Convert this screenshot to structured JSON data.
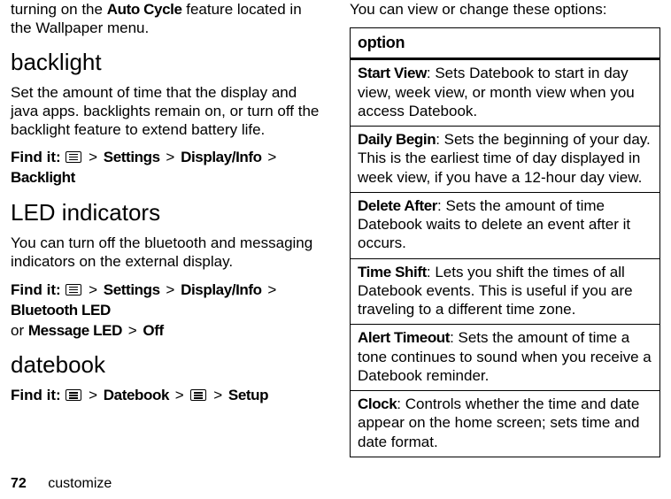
{
  "left": {
    "intro_pre": "turning on the ",
    "intro_bold": "Auto Cycle",
    "intro_post": " feature located in the Wallpaper menu.",
    "backlight_h": "backlight",
    "backlight_p": "Set the amount of time that the display and java apps. backlights remain on, or turn off the backlight feature to extend battery life.",
    "backlight_find_label": "Find it:",
    "backlight_find_s1": "Settings",
    "backlight_find_s2": "Display/Info",
    "backlight_find_s3": "Backlight",
    "led_h": "LED indicators",
    "led_p": "You can turn off the bluetooth and messaging indicators on the external display.",
    "led_find_label": "Find it:",
    "led_find_s1": "Settings",
    "led_find_s2": "Display/Info",
    "led_find_s3": "Bluetooth LED",
    "led_find_or": "or ",
    "led_find_s4": "Message LED",
    "led_find_s5": "Off",
    "datebook_h": "datebook",
    "datebook_find_label": "Find it:",
    "datebook_find_s1": "Datebook",
    "datebook_find_s2": "Setup"
  },
  "right": {
    "intro": "You can view or change these options:",
    "table_header": "option",
    "rows": [
      {
        "term": "Start View",
        "desc": ": Sets Datebook to start in day view, week view, or month view when you access Datebook."
      },
      {
        "term": "Daily Begin",
        "desc": ": Sets the beginning of your day. This is the earliest time of day displayed in week view, if you have a 12-hour day view."
      },
      {
        "term": "Delete After",
        "desc": ": Sets the amount of time Datebook waits to delete an event after it occurs."
      },
      {
        "term": "Time Shift",
        "desc": ": Lets you shift the times of all Datebook events. This is useful if you are traveling to a different time zone."
      },
      {
        "term": "Alert Timeout",
        "desc": ": Sets the amount of time a tone continues to sound when you receive a Datebook reminder."
      },
      {
        "term": "Clock",
        "desc": ": Controls whether the time and date appear on the home screen; sets time and date format."
      }
    ]
  },
  "footer": {
    "page": "72",
    "section": "customize"
  },
  "gt": ">"
}
